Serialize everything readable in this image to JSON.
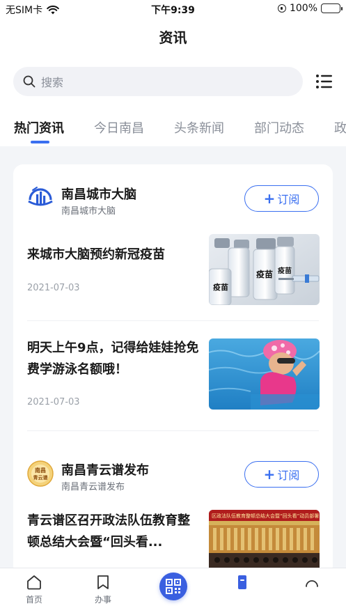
{
  "status_bar": {
    "carrier": "无SIM卡",
    "time": "下午9:39",
    "battery": "100%"
  },
  "header": {
    "title": "资讯"
  },
  "search": {
    "placeholder": "搜索"
  },
  "tabs": [
    {
      "label": "热门资讯",
      "active": true
    },
    {
      "label": "今日南昌",
      "active": false
    },
    {
      "label": "头条新闻",
      "active": false
    },
    {
      "label": "部门动态",
      "active": false
    },
    {
      "label": "政",
      "active": false
    }
  ],
  "sources": [
    {
      "name": "南昌城市大脑",
      "subtitle": "南昌城市大脑",
      "subscribe_label": "订阅",
      "articles": [
        {
          "title": "来城市大脑预约新冠疫苗",
          "date": "2021-07-03",
          "image_text": [
            "疫苗",
            "疫苗",
            "疫苗"
          ]
        },
        {
          "title": "明天上午9点，记得给娃娃抢免费学游泳名额哦！",
          "date": "2021-07-03"
        }
      ]
    },
    {
      "name": "南昌青云谱发布",
      "subtitle": "南昌青云谱发布",
      "subscribe_label": "订阅",
      "logo_text": "南昌青云谱",
      "articles": [
        {
          "title": "青云谱区召开政法队伍教育整顿总结大会暨“回头看...",
          "image_text": "区政法队伍教育整顿总结大会暨“回头看”动员部署"
        }
      ]
    }
  ],
  "tabbar": {
    "items": [
      {
        "label": "首页",
        "icon": "home-icon"
      },
      {
        "label": "办事",
        "icon": "bookmark-icon"
      },
      {
        "label": "",
        "icon": "qr-code-icon"
      },
      {
        "label": "",
        "icon": "news-icon",
        "active": true
      },
      {
        "label": "",
        "icon": "profile-icon"
      }
    ]
  },
  "colors": {
    "accent": "#3a6ff0",
    "background": "#f3f5f8",
    "card": "#ffffff",
    "battery": "#34c759"
  }
}
